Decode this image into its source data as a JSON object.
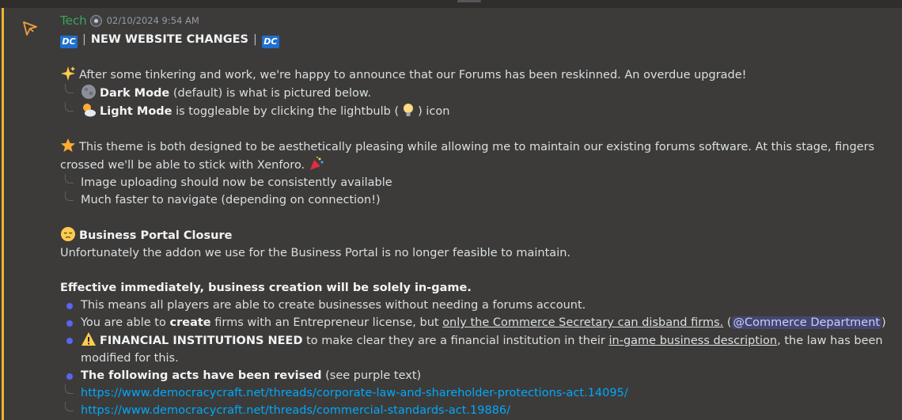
{
  "message": {
    "author": "Tech",
    "timestamp": "02/10/2024 9:54 AM",
    "header": {
      "badge_text": "DC",
      "title": "NEW WEBSITE CHANGES",
      "separator": "|"
    },
    "intro": "After some tinkering and work, we're happy to announce that our Forums has been reskinned. An overdue upgrade!",
    "dark_mode_bold": "Dark Mode",
    "dark_mode_rest": " (default) is what is pictured below.",
    "light_mode_bold": "Light Mode",
    "light_mode_rest_a": " is toggleable by clicking the lightbulb (",
    "light_mode_rest_b": ") icon",
    "theme_text": "This theme is both designed to be aesthetically pleasing while allowing me to maintain our existing forums software. At this stage, fingers crossed we'll be able to stick with Xenforo.",
    "theme_sub1": "Image uploading should now be consistently available",
    "theme_sub2": "Much faster to navigate (depending on connection!)",
    "portal_title": "Business Portal Closure",
    "portal_text": "Unfortunately the addon we use for the Business Portal is no longer feasible to maintain.",
    "effective": "Effective immediately, business creation will be solely in-game.",
    "bullet1": "This means all players are able to create businesses without needing a forums account.",
    "bullet2_a": "You are able to ",
    "bullet2_bold": "create",
    "bullet2_b": " firms with an Entrepreneur license, but ",
    "bullet2_u": "only the Commerce Secretary can disband firms.",
    "bullet2_c": " (",
    "bullet2_mention": "@Commerce Department",
    "bullet2_d": ")",
    "bullet3_bold": "FINANCIAL INSTITUTIONS NEED",
    "bullet3_a": " to make clear they are a financial institution in their ",
    "bullet3_u": "in-game business description",
    "bullet3_b": ", the law has been modified for this.",
    "bullet4_bold": "The following acts have been revised",
    "bullet4_rest": " (see purple text)",
    "link1": "https://www.democracycraft.net/threads/corporate-law-and-shareholder-protections-act.14095/",
    "link2": "https://www.democracycraft.net/threads/commercial-standards-act.19886/"
  },
  "icons": {
    "app": "pointer-icon",
    "sparkles": "sparkles-icon",
    "moon": "moon-icon",
    "sun": "sun-behind-cloud-icon",
    "bulb": "lightbulb-icon",
    "star": "star-icon",
    "party": "party-popper-icon",
    "pensive": "pensive-face-icon",
    "warning": "warning-icon"
  },
  "colors": {
    "background": "#3c3b39",
    "highlight": "#f0b232",
    "author": "#3ba55d",
    "link": "#00a8fc",
    "bullet": "#5865f2"
  }
}
